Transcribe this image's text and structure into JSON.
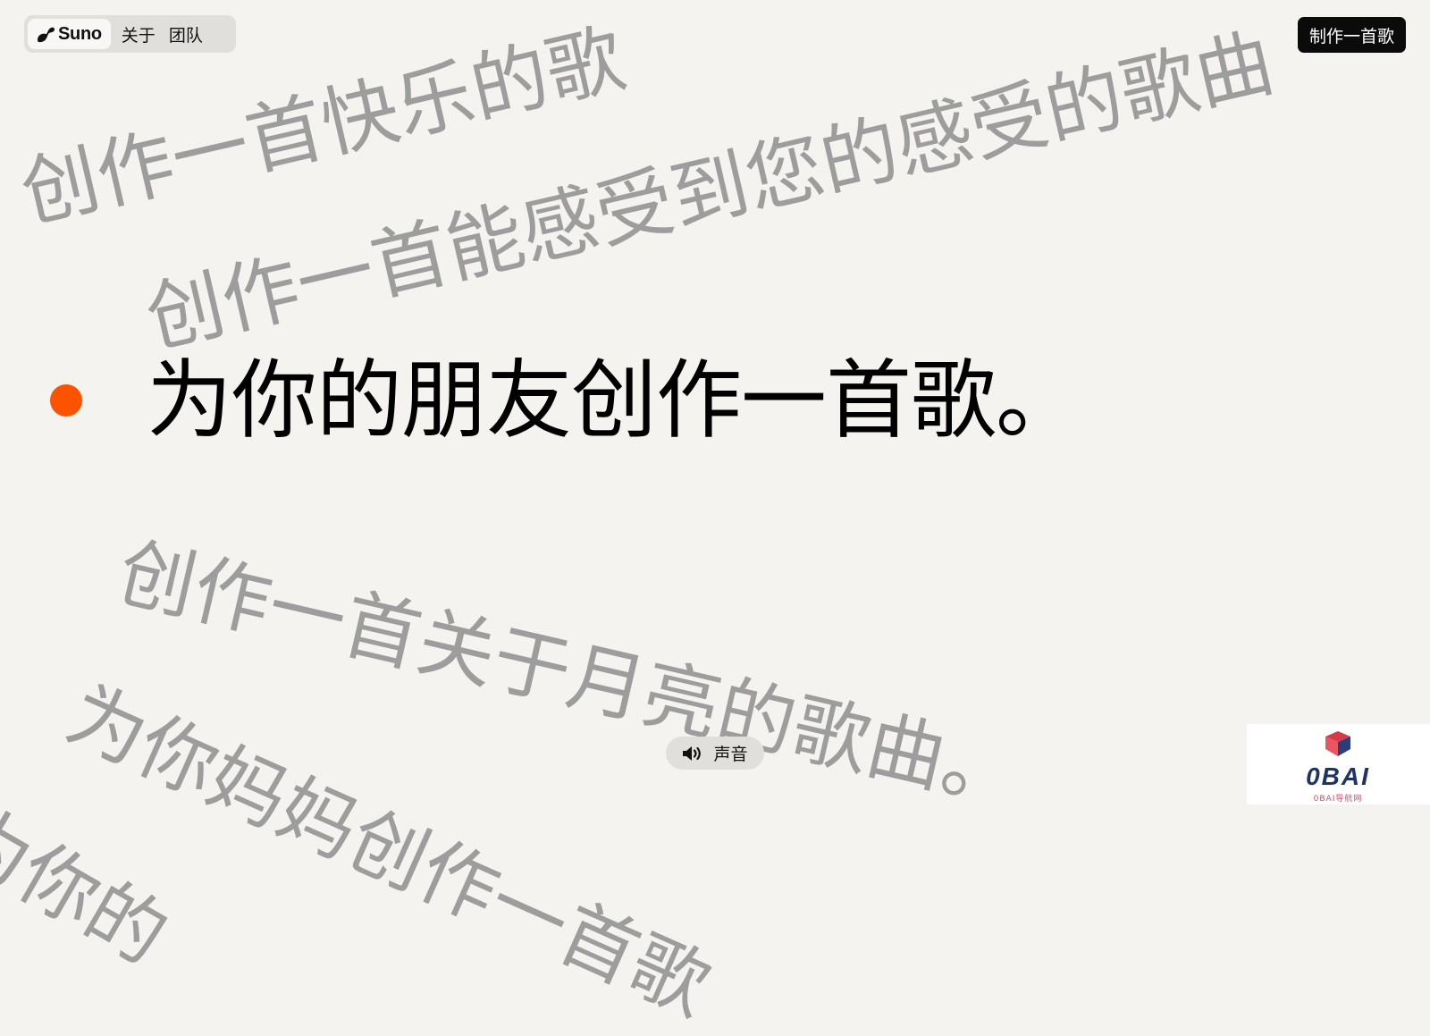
{
  "nav": {
    "logo_text": "Suno",
    "logo_icon": "suno-wave-icon",
    "links": [
      "关于",
      "团队"
    ]
  },
  "cta_label": "制作一首歌",
  "background_phrases": [
    "创作一首快乐的歌",
    "创作一首能感受到您的感受的歌曲",
    "创作一首关于月亮的歌曲。",
    "为你妈妈创作一首歌",
    "为你的"
  ],
  "hero": {
    "text": "为你的朋友创作一首歌。",
    "accent_color": "#fd5200"
  },
  "sound": {
    "label": "声音",
    "icon": "speaker-icon"
  },
  "watermark": {
    "text": "0BAI",
    "subtext": "0BAI导航网"
  },
  "colors": {
    "background": "#f4f3f0",
    "phrase_gray": "#9d9d9d",
    "cta_bg": "#0b0b0b",
    "pill_bg": "#e1dfdb"
  }
}
